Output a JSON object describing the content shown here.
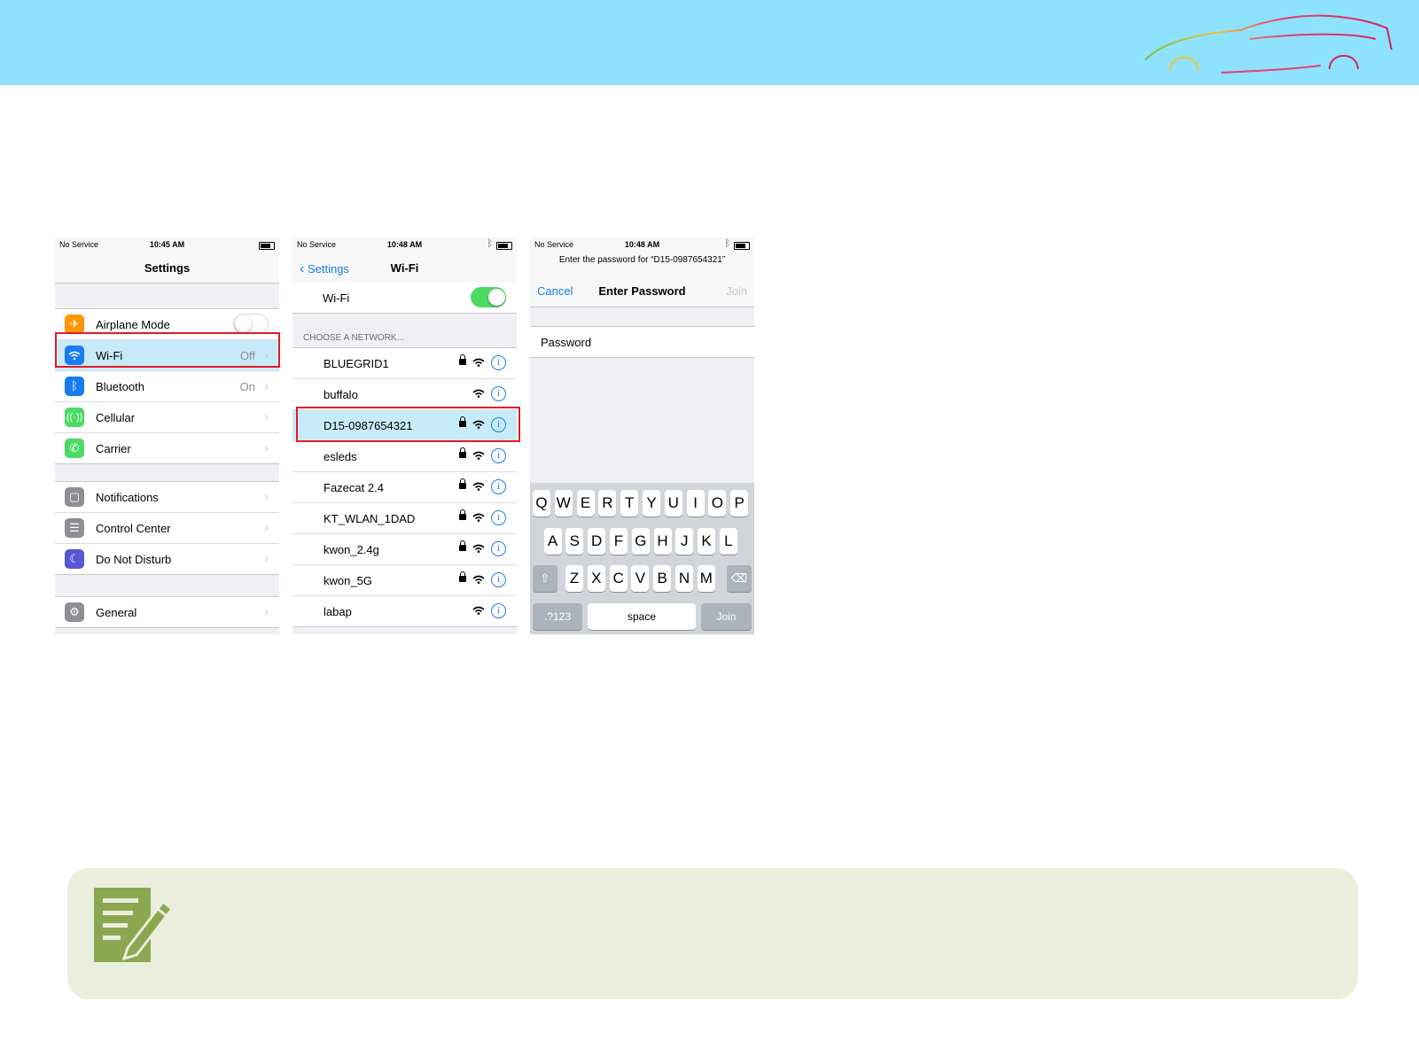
{
  "colors": {
    "banner": "#8ee2fd",
    "ios_blue": "#1a7cf4",
    "highlight_box": "#e41b23",
    "row_highlight": "#c8ebfb",
    "toggle_on": "#4cd964",
    "note_bg": "#ebeedc",
    "note_icon": "#8ba851"
  },
  "settings_screen": {
    "status": {
      "carrier": "No Service",
      "time": "10:45 AM"
    },
    "title": "Settings",
    "group1": [
      {
        "label": "Airplane Mode",
        "value": "",
        "icon": "airplane-icon",
        "color": "#ff9500"
      },
      {
        "label": "Wi-Fi",
        "value": "Off",
        "icon": "wifi-icon",
        "color": "#1a7cf4"
      },
      {
        "label": "Bluetooth",
        "value": "On",
        "icon": "bluetooth-icon",
        "color": "#1a7cf4"
      },
      {
        "label": "Cellular",
        "value": "",
        "icon": "cellular-icon",
        "color": "#4cd964"
      },
      {
        "label": "Carrier",
        "value": "",
        "icon": "phone-icon",
        "color": "#4cd964"
      }
    ],
    "group2": [
      {
        "label": "Notifications",
        "icon": "notifications-icon",
        "color": "#8e8e93"
      },
      {
        "label": "Control Center",
        "icon": "control-center-icon",
        "color": "#8e8e93"
      },
      {
        "label": "Do Not Disturb",
        "icon": "moon-icon",
        "color": "#5856d6"
      }
    ],
    "group3": [
      {
        "label": "General",
        "icon": "gear-icon",
        "color": "#8e8e93"
      }
    ]
  },
  "wifi_screen": {
    "status": {
      "carrier": "No Service",
      "time": "10:48 AM"
    },
    "back_label": "Settings",
    "title": "Wi-Fi",
    "wifi_label": "Wi-Fi",
    "section_header": "CHOOSE A NETWORK...",
    "networks": [
      {
        "name": "BLUEGRID1",
        "locked": true
      },
      {
        "name": "buffalo",
        "locked": false
      },
      {
        "name": "D15-0987654321",
        "locked": true
      },
      {
        "name": "esleds",
        "locked": true
      },
      {
        "name": "Fazecat 2.4",
        "locked": true
      },
      {
        "name": "KT_WLAN_1DAD",
        "locked": true
      },
      {
        "name": "kwon_2.4g",
        "locked": true
      },
      {
        "name": "kwon_5G",
        "locked": true
      },
      {
        "name": "labap",
        "locked": false
      }
    ]
  },
  "password_screen": {
    "status": {
      "carrier": "No Service",
      "time": "10:48 AM"
    },
    "prompt": "Enter the password for “D15-0987654321”",
    "cancel_label": "Cancel",
    "title": "Enter Password",
    "join_label": "Join",
    "field_label": "Password",
    "keyboard": {
      "row1": [
        "Q",
        "W",
        "E",
        "R",
        "T",
        "Y",
        "U",
        "I",
        "O",
        "P"
      ],
      "row2": [
        "A",
        "S",
        "D",
        "F",
        "G",
        "H",
        "J",
        "K",
        "L"
      ],
      "row3": [
        "Z",
        "X",
        "C",
        "V",
        "B",
        "N",
        "M"
      ],
      "numbers_label": ".?123",
      "space_label": "space",
      "join_label": "Join"
    }
  }
}
